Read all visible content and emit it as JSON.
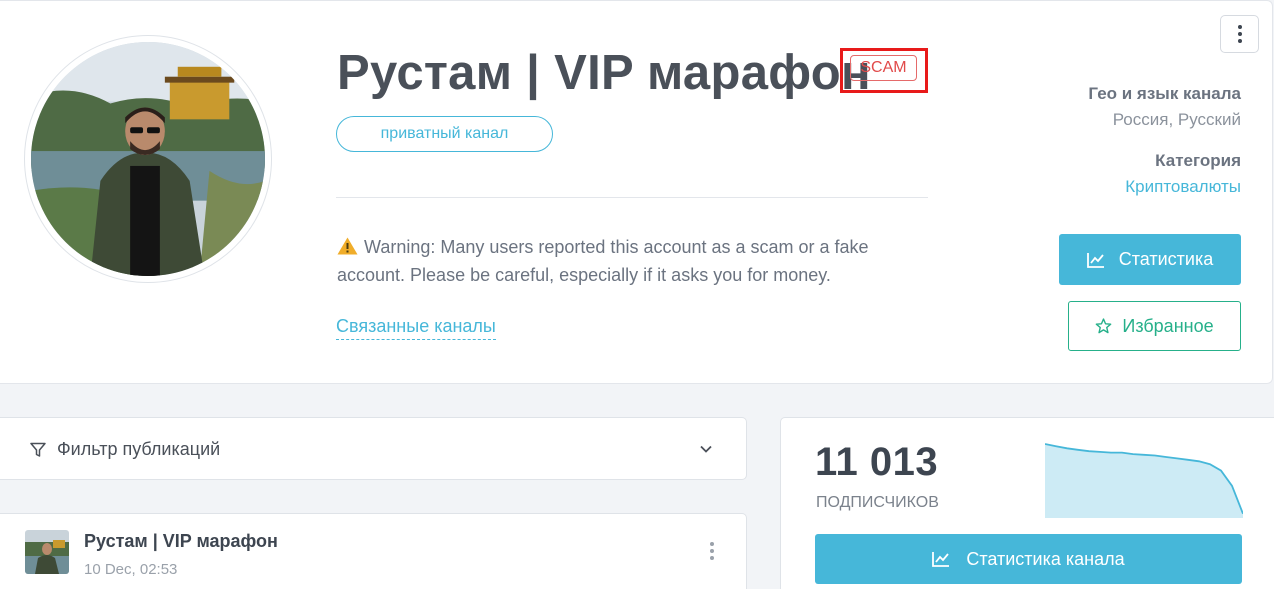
{
  "channel": {
    "title": "Рустам | VIP марафон",
    "scam_badge": "SCAM",
    "type_pill": "приватный канал",
    "warning": "Warning: Many users reported this account as a scam or a fake account. Please be careful, especially if it asks you for money.",
    "related_link": "Связанные каналы"
  },
  "meta": {
    "geo_label": "Гео и язык канала",
    "geo_value": "Россия, Русский",
    "category_label": "Категория",
    "category_value": "Криптовалюты"
  },
  "buttons": {
    "stats": "Статистика",
    "favorite": "Избранное",
    "channel_stats": "Статистика канала"
  },
  "filter": {
    "label": "Фильтр публикаций"
  },
  "post": {
    "title": "Рустам | VIP марафон",
    "date": "10 Dec, 02:53"
  },
  "subscribers": {
    "count": "11 013",
    "label": "ПОДПИСЧИКОВ",
    "trend": [
      100,
      97,
      94,
      92,
      90,
      89,
      88,
      88,
      86,
      85,
      84,
      82,
      80,
      78,
      76,
      72,
      63,
      42,
      3
    ]
  },
  "colors": {
    "accent": "#46b7d9",
    "favorite": "#26b08a",
    "scam": "#e81a1a"
  },
  "icons": [
    "kebab-menu-icon",
    "warning-icon",
    "chart-line-icon",
    "star-icon",
    "filter-icon",
    "chevron-down-icon"
  ]
}
